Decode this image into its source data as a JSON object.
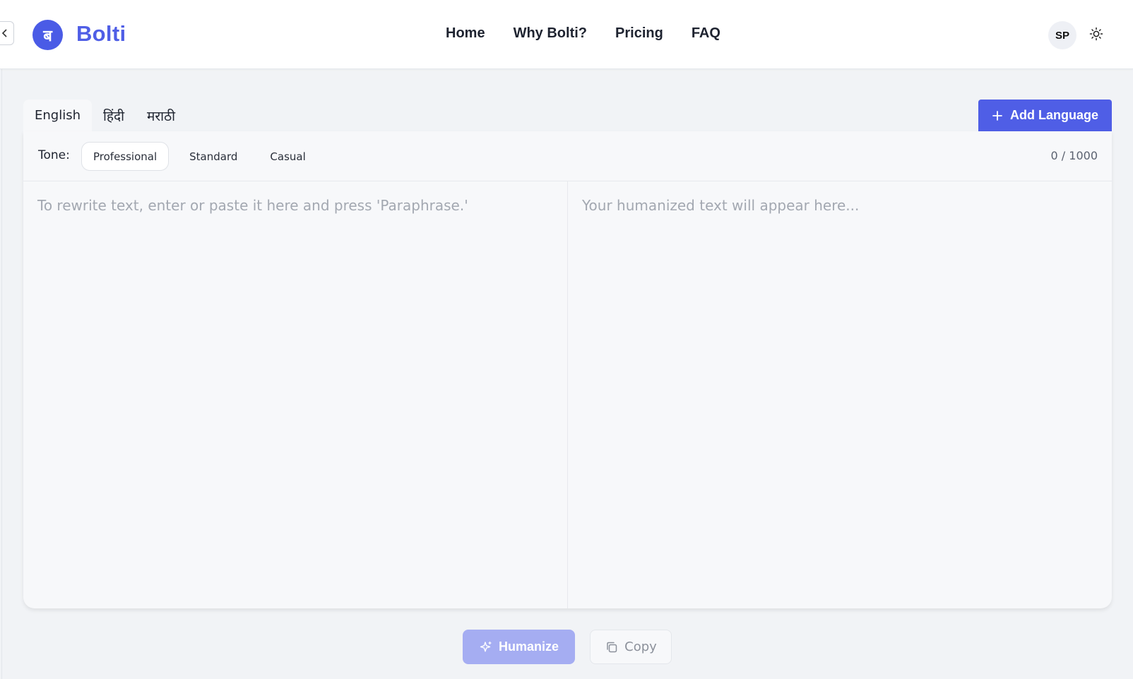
{
  "header": {
    "logo_glyph": "ब",
    "brand": "Bolti",
    "nav": [
      {
        "label": "Home"
      },
      {
        "label": "Why Bolti?"
      },
      {
        "label": "Pricing"
      },
      {
        "label": "FAQ"
      }
    ],
    "avatar_initials": "SP",
    "theme_icon": "sun-icon",
    "collapse_icon": "chevron-left-icon"
  },
  "languages": {
    "tabs": [
      {
        "label": "English",
        "active": true
      },
      {
        "label": "हिंदी",
        "active": false
      },
      {
        "label": "मराठी",
        "active": false
      }
    ],
    "add_label": "Add Language",
    "add_icon": "plus-icon"
  },
  "editor": {
    "tone_label": "Tone:",
    "tones": [
      {
        "label": "Professional",
        "active": true
      },
      {
        "label": "Standard",
        "active": false
      },
      {
        "label": "Casual",
        "active": false
      }
    ],
    "counter": "0 / 1000",
    "input_placeholder": "To rewrite text, enter or paste it here and press 'Paraphrase.'",
    "output_placeholder": "Your humanized text will appear here..."
  },
  "actions": {
    "humanize_label": "Humanize",
    "humanize_icon": "sparkle-icon",
    "copy_label": "Copy",
    "copy_icon": "copy-icon"
  },
  "colors": {
    "accent": "#4f5ee6",
    "accent_disabled": "#a5adf2",
    "background": "#f1f3f6",
    "card": "#f7f8fa"
  }
}
